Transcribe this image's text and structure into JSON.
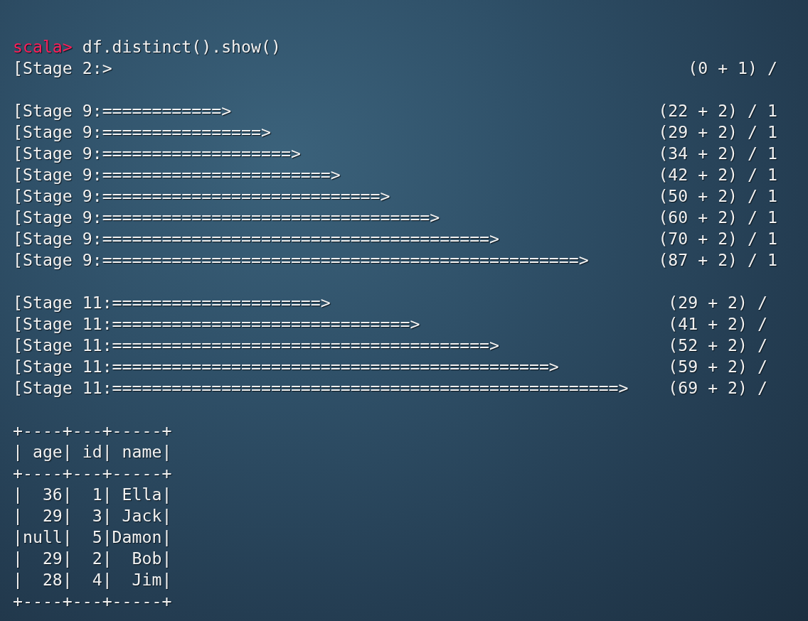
{
  "prompt": {
    "label": "scala>",
    "command": "df.distinct().show()"
  },
  "stage_groups": [
    {
      "lines": [
        {
          "stage": "[Stage 2:",
          "bar": ">",
          "count": "(0 + 1) /"
        }
      ]
    },
    {
      "lines": [
        {
          "stage": "[Stage 9:",
          "bar": "============>",
          "count": "(22 + 2) / 1"
        },
        {
          "stage": "[Stage 9:",
          "bar": "================>",
          "count": "(29 + 2) / 1"
        },
        {
          "stage": "[Stage 9:",
          "bar": "===================>",
          "count": "(34 + 2) / 1"
        },
        {
          "stage": "[Stage 9:",
          "bar": "=======================>",
          "count": "(42 + 2) / 1"
        },
        {
          "stage": "[Stage 9:",
          "bar": "============================>",
          "count": "(50 + 2) / 1"
        },
        {
          "stage": "[Stage 9:",
          "bar": "=================================>",
          "count": "(60 + 2) / 1"
        },
        {
          "stage": "[Stage 9:",
          "bar": "=======================================>",
          "count": "(70 + 2) / 1"
        },
        {
          "stage": "[Stage 9:",
          "bar": "================================================>",
          "count": "(87 + 2) / 1"
        }
      ]
    },
    {
      "lines": [
        {
          "stage": "[Stage 11:",
          "bar": "=====================>",
          "count": "(29 + 2) /"
        },
        {
          "stage": "[Stage 11:",
          "bar": "==============================>",
          "count": "(41 + 2) /"
        },
        {
          "stage": "[Stage 11:",
          "bar": "======================================>",
          "count": "(52 + 2) /"
        },
        {
          "stage": "[Stage 11:",
          "bar": "============================================>",
          "count": "(59 + 2) /"
        },
        {
          "stage": "[Stage 11:",
          "bar": "===================================================>",
          "count": "(69 + 2) /"
        }
      ]
    }
  ],
  "table": {
    "border_top": "+----+---+-----+",
    "header": "| age| id| name|",
    "border_mid": "+----+---+-----+",
    "rows": [
      "|  36|  1| Ella|",
      "|  29|  3| Jack|",
      "|null|  5|Damon|",
      "|  29|  2|  Bob|",
      "|  28|  4|  Jim|"
    ],
    "border_bottom": "+----+---+-----+"
  }
}
